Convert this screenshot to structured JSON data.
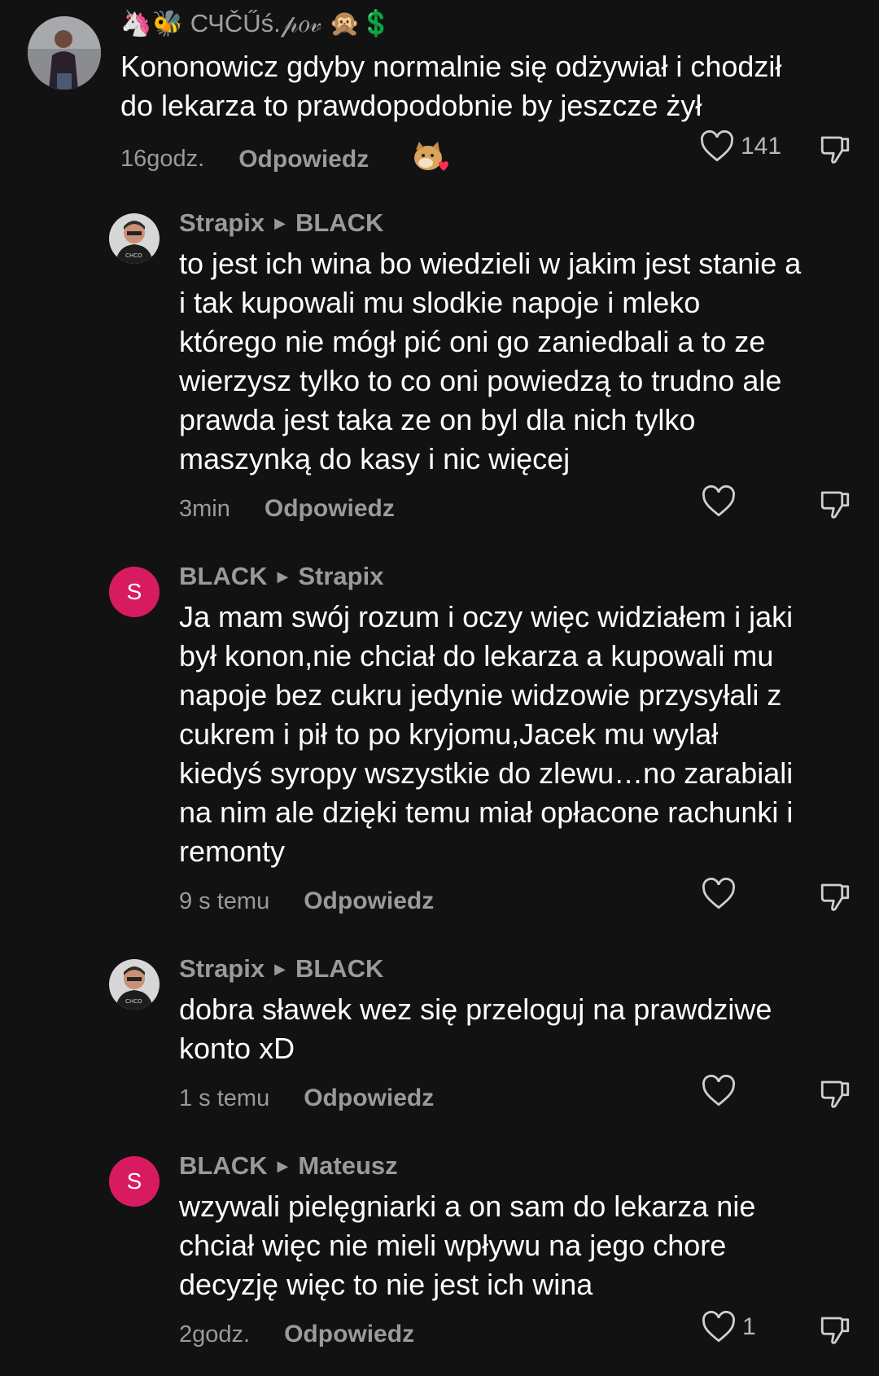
{
  "comments": [
    {
      "author": "🦄🐝 СЧČŰś.𝓅𝑜𝓋 🙊💲",
      "text": "Kononowicz gdyby normalnie się odżywiał i chodził\ndo lekarza to prawdopodobnie by jeszcze żył",
      "time": "16godz.",
      "reply_label": "Odpowiedz",
      "likes": "141"
    },
    {
      "author": "Strapix",
      "reply_to": "BLACK",
      "text": "to jest ich wina bo wiedzieli w jakim jest stanie a\ni tak kupowali mu slodkie napoje i mleko\nktórego nie mógł pić oni go zaniedbali a to ze\nwierzysz tylko to co oni powiedzą to trudno ale\nprawda jest taka ze on byl dla nich tylko\nmaszynką do kasy i nic więcej",
      "time": "3min",
      "reply_label": "Odpowiedz",
      "likes": ""
    },
    {
      "author": "BLACK",
      "reply_to": "Strapix",
      "avatar_letter": "S",
      "text": "Ja mam swój rozum i oczy więc widziałem i jaki\nbył konon,nie chciał do lekarza a kupowali mu\nnapoje bez cukru jedynie widzowie przysyłali z\ncukrem i pił to po kryjomu,Jacek mu wylał\nkiedyś syropy wszystkie do zlewu…no zarabiali\nna nim ale dzięki temu miał opłacone rachunki i\nremonty",
      "time": "9 s temu",
      "reply_label": "Odpowiedz",
      "likes": ""
    },
    {
      "author": "Strapix",
      "reply_to": "BLACK",
      "text": "dobra sławek wez się przeloguj na prawdziwe\nkonto xD",
      "time": "1 s temu",
      "reply_label": "Odpowiedz",
      "likes": ""
    },
    {
      "author": "BLACK",
      "reply_to": "Mateusz",
      "avatar_letter": "S",
      "text": "wzywali pielęgniarki a on sam do lekarza nie\nchciał więc nie mieli wpływu na jego chore\ndecyzję więc to nie jest ich wina",
      "time": "2godz.",
      "reply_label": "Odpowiedz",
      "likes": "1"
    }
  ],
  "icons": {
    "like": "heart-outline-icon",
    "dislike": "thumbs-down-icon",
    "reply_arrow": "triangle-right-icon",
    "sticker": "doge-heart-sticker"
  },
  "colors": {
    "background": "#121212",
    "avatar_letter_bg": "#d81b60",
    "secondary_text": "#9a9a9a"
  }
}
